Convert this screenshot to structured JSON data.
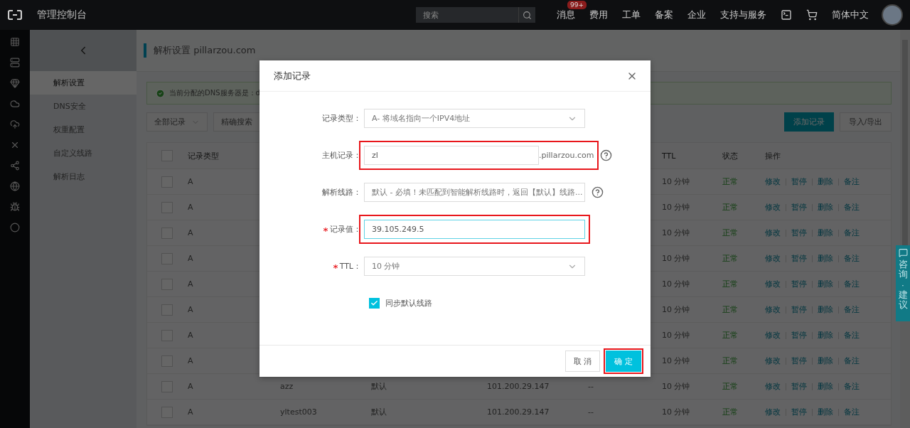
{
  "topbar": {
    "title": "管理控制台",
    "search": {
      "placeholder": "搜索"
    },
    "nav": [
      {
        "label": "消息",
        "badge": "99+"
      },
      {
        "label": "费用"
      },
      {
        "label": "工单"
      },
      {
        "label": "备案"
      },
      {
        "label": "企业"
      },
      {
        "label": "支持与服务"
      }
    ],
    "language": "简体中文"
  },
  "sidebar": {
    "items": [
      {
        "label": "解析设置",
        "selected": true
      },
      {
        "label": "DNS安全",
        "selected": false
      },
      {
        "label": "权重配置",
        "selected": false
      },
      {
        "label": "自定义线路",
        "selected": false
      },
      {
        "label": "解析日志",
        "selected": false
      }
    ]
  },
  "page": {
    "title": "解析设置 pillarzou.com",
    "notice": "当前分配的DNS服务器是：d",
    "filters": [
      "全部记录",
      "精确搜索"
    ],
    "buttons": [
      {
        "label": "添加记录",
        "primary": true
      },
      {
        "label": "导入/导出",
        "primary": false
      }
    ]
  },
  "table": {
    "all_checked": false,
    "columns": {
      "type": "记录类型",
      "ttl": "TTL",
      "status": "状态",
      "actions": "操作"
    },
    "rows": [
      {
        "checked": false,
        "type": "A",
        "ttl": "10 分钟",
        "status": "正常",
        "actions": [
          "修改",
          "暂停",
          "删除",
          "备注"
        ]
      },
      {
        "checked": false,
        "type": "A",
        "ttl": "10 分钟",
        "status": "正常",
        "actions": [
          "修改",
          "暂停",
          "删除",
          "备注"
        ]
      },
      {
        "checked": false,
        "type": "A",
        "ttl": "10 分钟",
        "status": "正常",
        "actions": [
          "修改",
          "暂停",
          "删除",
          "备注"
        ]
      },
      {
        "checked": false,
        "type": "A",
        "ttl": "10 分钟",
        "status": "正常",
        "actions": [
          "修改",
          "暂停",
          "删除",
          "备注"
        ]
      },
      {
        "checked": false,
        "type": "A",
        "ttl": "10 分钟",
        "status": "正常",
        "actions": [
          "修改",
          "暂停",
          "删除",
          "备注"
        ]
      },
      {
        "checked": false,
        "type": "A",
        "ttl": "10 分钟",
        "status": "正常",
        "actions": [
          "修改",
          "暂停",
          "删除",
          "备注"
        ]
      },
      {
        "checked": false,
        "type": "A",
        "ttl": "10 分钟",
        "status": "正常",
        "actions": [
          "修改",
          "暂停",
          "删除",
          "备注"
        ]
      },
      {
        "checked": false,
        "type": "A",
        "ttl": "10 分钟",
        "status": "正常",
        "actions": [
          "修改",
          "暂停",
          "删除",
          "备注"
        ]
      },
      {
        "checked": false,
        "type": "A",
        "host": "azz",
        "line": "默认",
        "value": "101.200.29.147",
        "mx": "--",
        "ttl": "10 分钟",
        "status": "正常",
        "actions": [
          "修改",
          "暂停",
          "删除",
          "备注"
        ]
      },
      {
        "checked": false,
        "type": "A",
        "host": "yltest003",
        "line": "默认",
        "value": "101.200.29.147",
        "mx": "--",
        "ttl": "10 分钟",
        "status": "正常",
        "actions": [
          "修改",
          "暂停",
          "删除",
          "备注"
        ]
      }
    ]
  },
  "feedback_tab": {
    "label": "咨询·建议"
  },
  "dialog": {
    "title": "添加记录",
    "fields": [
      {
        "kind": "select",
        "label": "记录类型：",
        "value": "A- 将域名指向一个IPV4地址",
        "highlighted": false,
        "focused": false
      },
      {
        "kind": "input",
        "label": "主机记录：",
        "value": "zl",
        "suffix": ".pillarzou.com",
        "highlighted": true,
        "focused": false,
        "help": true
      },
      {
        "kind": "select",
        "label": "解析线路：",
        "value": "默认 - 必填！未匹配到智能解析线路时，返回【默认】线路...",
        "highlighted": false,
        "focused": false,
        "help": true
      },
      {
        "kind": "input",
        "label": "记录值：",
        "value": "39.105.249.5",
        "required": true,
        "highlighted": true,
        "focused": true
      },
      {
        "kind": "select",
        "label": "TTL：",
        "value": "10 分钟",
        "required": true,
        "highlighted": false,
        "focused": false
      },
      {
        "kind": "checkbox",
        "label": "同步默认线路",
        "checked": true
      }
    ],
    "buttons": [
      {
        "label": "取 消",
        "primary": false,
        "highlighted": false
      },
      {
        "label": "确 定",
        "primary": true,
        "highlighted": true
      }
    ]
  }
}
